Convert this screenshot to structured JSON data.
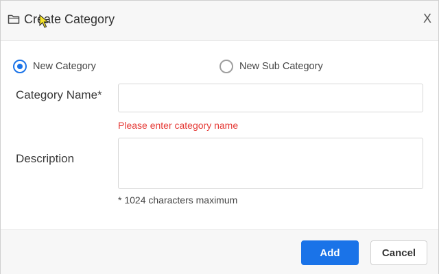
{
  "dialog": {
    "title": "Create Category",
    "close_label": "X",
    "folder_icon": "folder-icon"
  },
  "mode": {
    "options": [
      {
        "label": "New Category",
        "selected": true
      },
      {
        "label": "New Sub Category",
        "selected": false
      }
    ]
  },
  "fields": {
    "name": {
      "label": "Category Name*",
      "value": "",
      "error": "Please enter category name"
    },
    "description": {
      "label": "Description",
      "value": "",
      "hint": "* 1024 characters maximum"
    }
  },
  "footer": {
    "add_label": "Add",
    "cancel_label": "Cancel"
  },
  "colors": {
    "accent": "#1a73e8",
    "error": "#e53935"
  }
}
